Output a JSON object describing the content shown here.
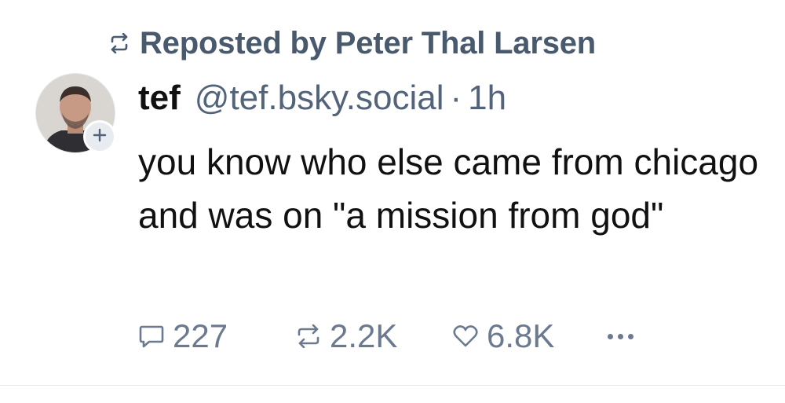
{
  "repost": {
    "text": "Reposted by Peter Thal Larsen"
  },
  "post": {
    "display_name": "tef",
    "handle": "@tef.bsky.social",
    "separator": "·",
    "time": "1h",
    "text": "you know who else came from chicago and was on \"a mission from god\""
  },
  "actions": {
    "reply_count": "227",
    "repost_count": "2.2K",
    "like_count": "6.8K"
  },
  "icons": {
    "repost": "repost-icon",
    "reply": "reply-icon",
    "like": "heart-icon",
    "more": "more-icon",
    "follow": "plus-icon"
  },
  "colors": {
    "muted": "#6b7a90",
    "text": "#111111",
    "repost_label": "#4a5a6e"
  }
}
